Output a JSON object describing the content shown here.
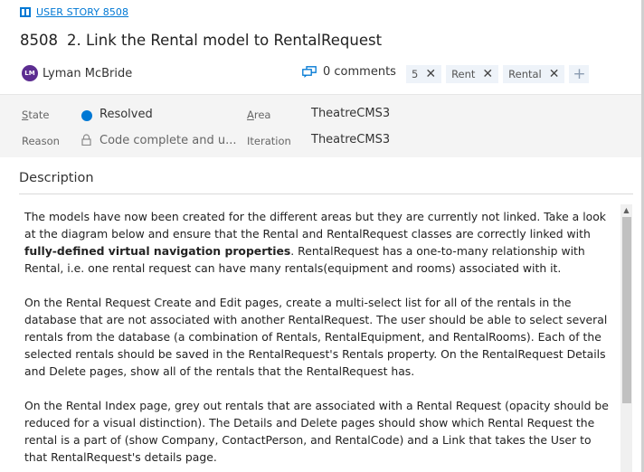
{
  "breadcrumb": {
    "label": "USER STORY 8508"
  },
  "work_item": {
    "id": "8508",
    "title": "2. Link the Rental model to RentalRequest"
  },
  "assignee": {
    "initials": "LM",
    "name": "Lyman McBride"
  },
  "comments": {
    "label": "0 comments"
  },
  "tags": [
    {
      "label": "5"
    },
    {
      "label": "Rent"
    },
    {
      "label": "Rental"
    }
  ],
  "fields": {
    "state_label": "State",
    "state_value": "Resolved",
    "reason_label": "Reason",
    "reason_value": "Code complete and u...",
    "area_label": "Area",
    "area_value": "TheatreCMS3",
    "iteration_label": "Iteration",
    "iteration_value": "TheatreCMS3"
  },
  "description": {
    "heading": "Description",
    "p1_a": "The models have now been created for the different areas but they are currently not linked. Take a look at the diagram below and ensure that the Rental and RentalRequest classes are correctly linked with ",
    "p1_bold": "fully-defined virtual navigation properties",
    "p1_b": ". RentalRequest has a one-to-many relationship with Rental, i.e. one rental request can have many rentals(equipment and rooms) associated with it.",
    "p2": "On the Rental Request Create and Edit pages, create a multi-select list for all of the rentals in the database that are not associated with another RentalRequest.  The user should be able to select several rentals from the database (a combination of Rentals, RentalEquipment, and RentalRooms).  Each of the selected rentals should be saved in the RentalRequest's Rentals property.  On the RentalRequest Details and Delete pages, show all of the rentals that the RentalRequest has.",
    "p3": "On the Rental Index page, grey out rentals that are associated with a Rental Request (opacity should be reduced for a visual distinction).  The Details and Delete pages should show which Rental Request the rental is a part of (show Company, ContactPerson, and RentalCode) and a Link that takes the User to that RentalRequest's details page."
  },
  "colors": {
    "accent": "#0078d4",
    "avatar": "#5c2d91",
    "tag_bg": "#eef3f9",
    "fields_bg": "#f4f4f4"
  },
  "icons": {
    "work_item": "book-icon",
    "comments": "comment-icon",
    "state": "state-dot-icon",
    "reason": "lock-icon",
    "tag_remove": "close-icon",
    "tag_add": "plus-icon"
  }
}
